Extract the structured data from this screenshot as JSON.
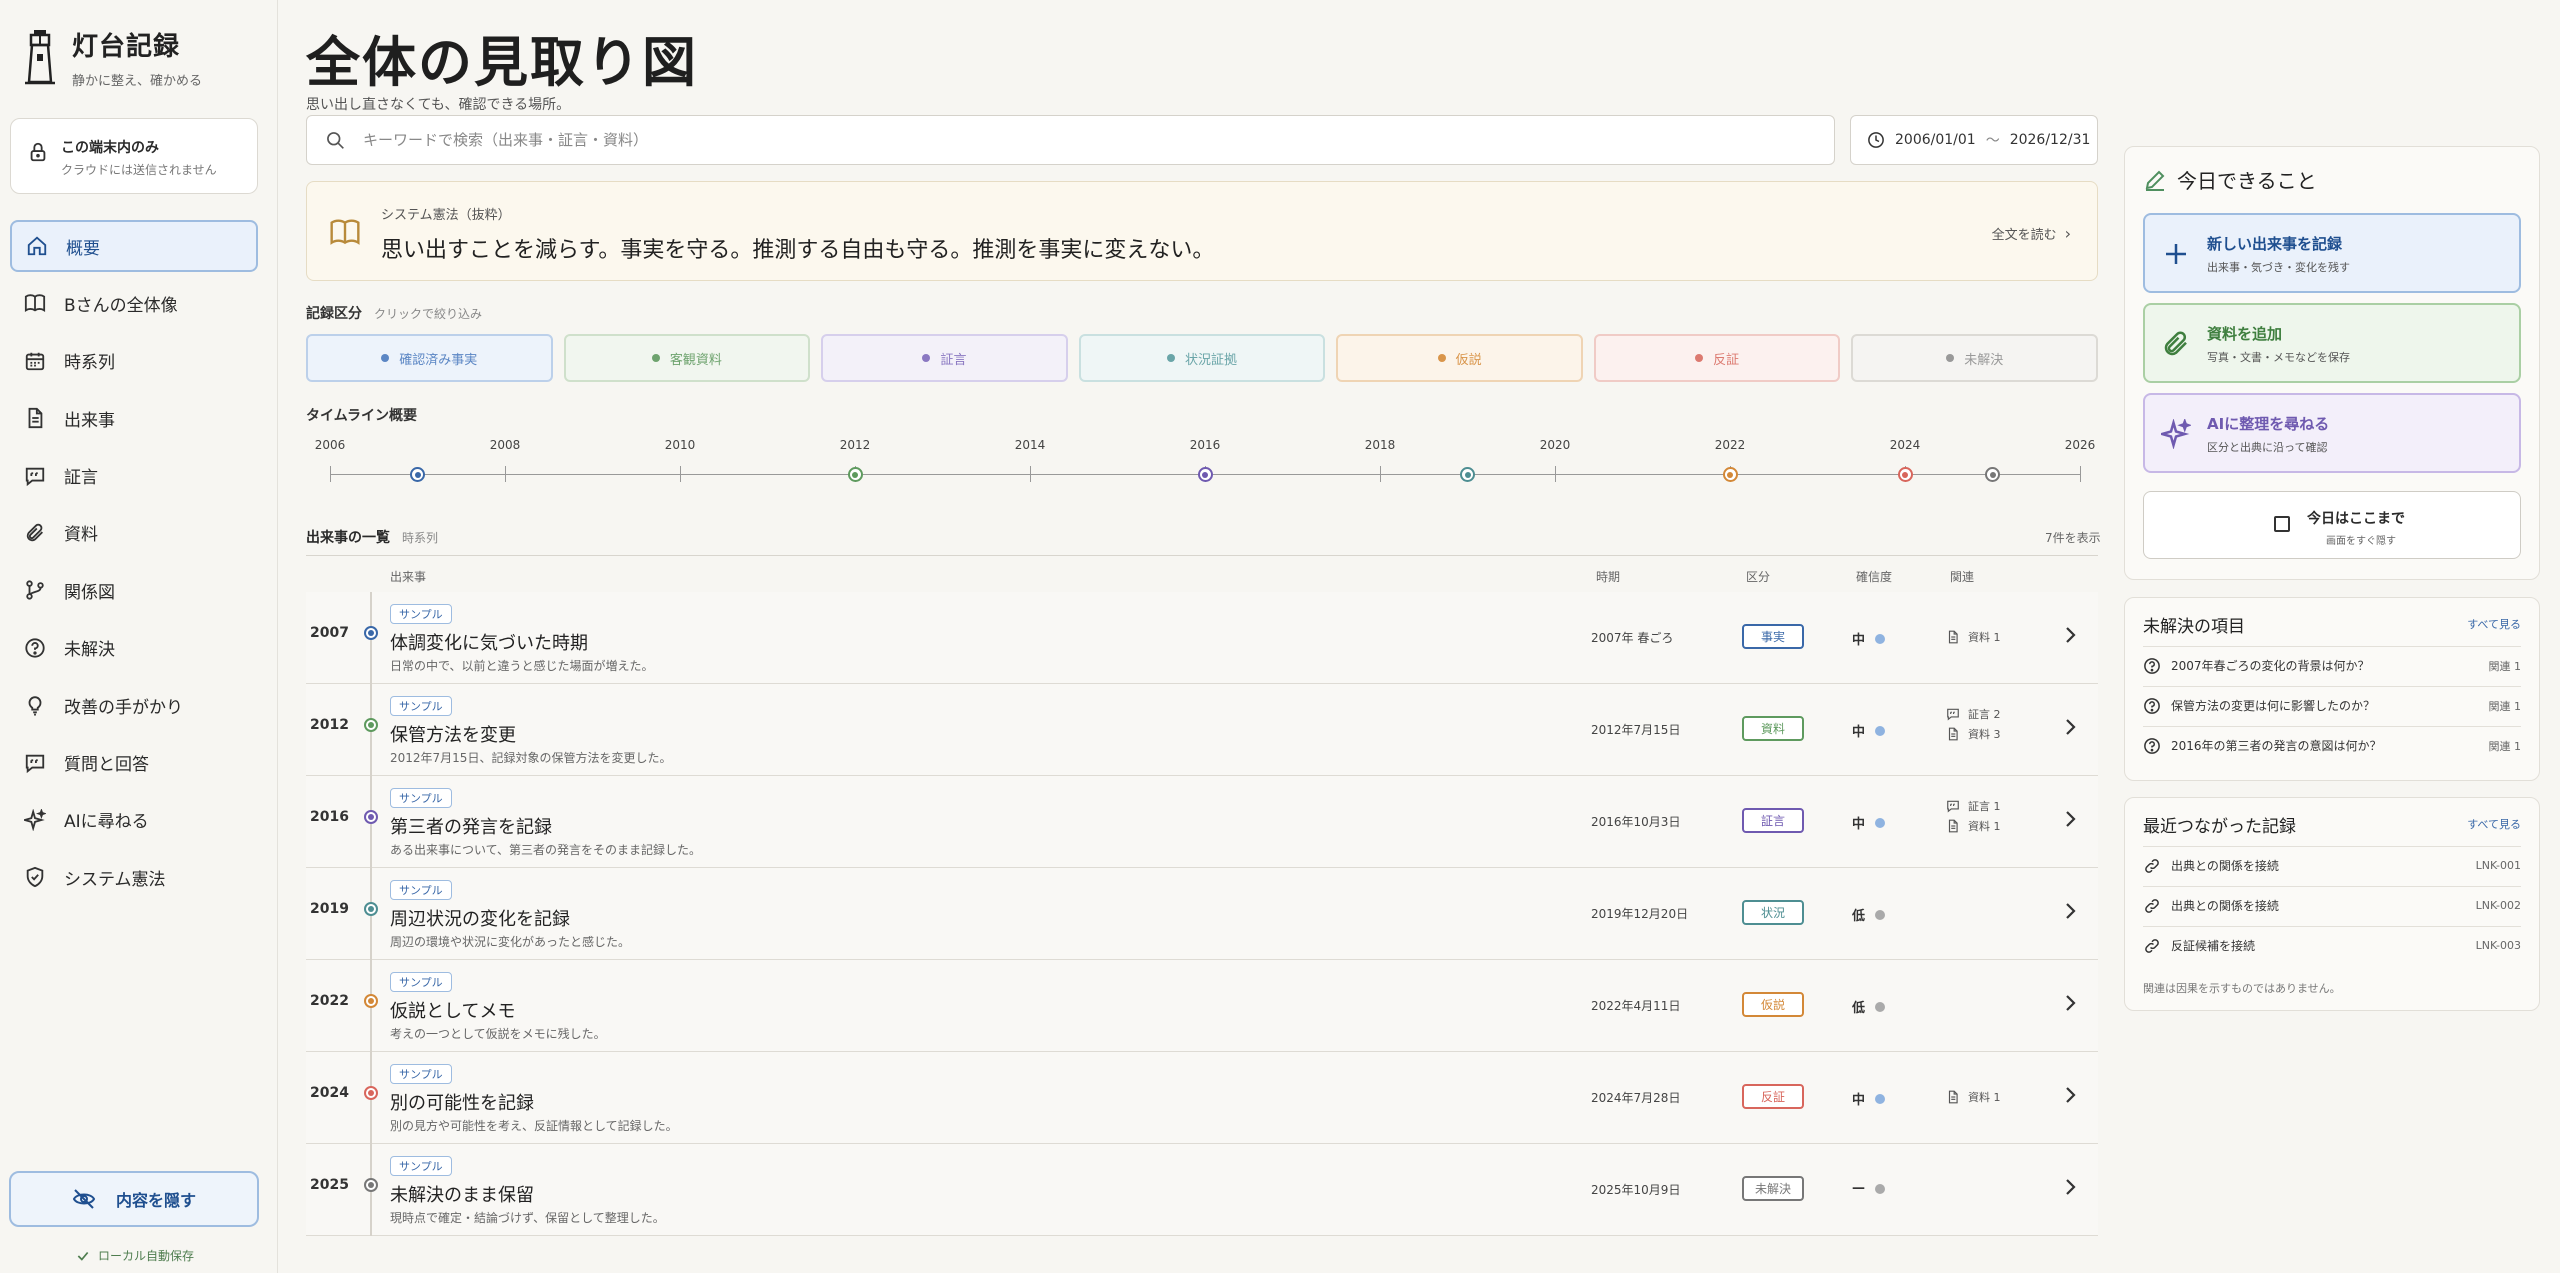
{
  "brand": {
    "title": "灯台記録",
    "subtitle": "静かに整え、確かめる"
  },
  "local_card": {
    "title": "この端末内のみ",
    "subtitle": "クラウドには送信されません"
  },
  "nav": [
    {
      "label": "概要",
      "icon": "home-icon"
    },
    {
      "label": "Bさんの全体像",
      "icon": "book-icon"
    },
    {
      "label": "時系列",
      "icon": "calendar-icon"
    },
    {
      "label": "出来事",
      "icon": "document-icon"
    },
    {
      "label": "証言",
      "icon": "quote-icon"
    },
    {
      "label": "資料",
      "icon": "paperclip-icon"
    },
    {
      "label": "関係図",
      "icon": "branch-icon"
    },
    {
      "label": "未解決",
      "icon": "question-icon"
    },
    {
      "label": "改善の手がかり",
      "icon": "lightbulb-icon"
    },
    {
      "label": "質問と回答",
      "icon": "chat-icon"
    },
    {
      "label": "AIに尋ねる",
      "icon": "sparkle-icon"
    },
    {
      "label": "システム憲法",
      "icon": "shield-icon"
    }
  ],
  "hide_button": "内容を隠す",
  "autosave": "ローカル自動保存",
  "page": {
    "title": "全体の見取り図",
    "subtitle": "思い出し直さなくても、確認できる場所。"
  },
  "search": {
    "placeholder": "キーワードで検索（出来事・証言・資料）"
  },
  "daterange": {
    "start": "2006/01/01",
    "sep": "〜",
    "end": "2026/12/31"
  },
  "constitution": {
    "label": "システム憲法（抜粋）",
    "text": "思い出すことを減らす。事実を守る。推測する自由も守る。推測を事実に変えない。",
    "link": "全文を読む"
  },
  "filters": {
    "heading": "記録区分",
    "hint": "クリックで絞り込み",
    "items": [
      {
        "label": "確認済み事実",
        "color": "#5b86c4",
        "bg": "#edf3fb",
        "border": "#bcd0ea"
      },
      {
        "label": "客観資料",
        "color": "#6ea36e",
        "bg": "#f1f6ef",
        "border": "#cfe0cb"
      },
      {
        "label": "証言",
        "color": "#8a78c2",
        "bg": "#f3f1f9",
        "border": "#d6cfec"
      },
      {
        "label": "状況証拠",
        "color": "#6aa5a8",
        "bg": "#eff6f6",
        "border": "#c9e0e0"
      },
      {
        "label": "仮説",
        "color": "#d9954a",
        "bg": "#fcf4ea",
        "border": "#efd4b4"
      },
      {
        "label": "反証",
        "color": "#dc7a70",
        "bg": "#fcf1ef",
        "border": "#f0cbc6"
      },
      {
        "label": "未解決",
        "color": "#999999",
        "bg": "#f5f4f2",
        "border": "#dcdad5"
      }
    ]
  },
  "timeline": {
    "heading": "タイムライン概要",
    "ticks": [
      "2006",
      "2008",
      "2010",
      "2012",
      "2014",
      "2016",
      "2018",
      "2020",
      "2022",
      "2024",
      "2026"
    ],
    "start_year": 2006,
    "end_year": 2026,
    "events": [
      {
        "year": 2007.0,
        "color": "#3a68a8"
      },
      {
        "year": 2012.0,
        "color": "#5e9a5e"
      },
      {
        "year": 2016.0,
        "color": "#6f5ab0"
      },
      {
        "year": 2019.0,
        "color": "#4e8e92"
      },
      {
        "year": 2022.0,
        "color": "#d38837"
      },
      {
        "year": 2024.0,
        "color": "#d8665c"
      },
      {
        "year": 2025.0,
        "color": "#777777"
      }
    ]
  },
  "list": {
    "heading": "出来事の一覧",
    "hint": "時系列",
    "count": "7件を表示",
    "columns": {
      "event": "出来事",
      "period": "時期",
      "category": "区分",
      "confidence": "確信度",
      "related": "関連"
    },
    "rows": [
      {
        "year": "2007",
        "tag": "サンプル",
        "title": "体調変化に気づいた時期",
        "desc": "日常の中で、以前と違うと感じた場面が増えた。",
        "date": "2007年 春ごろ",
        "badge": "事実",
        "badge_color": "#3a68a8",
        "conf": "中",
        "conf_color": "#8fb3e0",
        "node_color": "#3a68a8",
        "rel": [
          {
            "icon": "document-icon",
            "text": "資料 1"
          }
        ]
      },
      {
        "year": "2012",
        "tag": "サンプル",
        "title": "保管方法を変更",
        "desc": "2012年7月15日、記録対象の保管方法を変更した。",
        "date": "2012年7月15日",
        "badge": "資料",
        "badge_color": "#5e9a5e",
        "conf": "中",
        "conf_color": "#8fb3e0",
        "node_color": "#5e9a5e",
        "rel": [
          {
            "icon": "quote-icon",
            "text": "証言 2"
          },
          {
            "icon": "document-icon",
            "text": "資料 3"
          }
        ]
      },
      {
        "year": "2016",
        "tag": "サンプル",
        "title": "第三者の発言を記録",
        "desc": "ある出来事について、第三者の発言をそのまま記録した。",
        "date": "2016年10月3日",
        "badge": "証言",
        "badge_color": "#6f5ab0",
        "conf": "中",
        "conf_color": "#8fb3e0",
        "node_color": "#6f5ab0",
        "rel": [
          {
            "icon": "quote-icon",
            "text": "証言 1"
          },
          {
            "icon": "document-icon",
            "text": "資料 1"
          }
        ]
      },
      {
        "year": "2019",
        "tag": "サンプル",
        "title": "周辺状況の変化を記録",
        "desc": "周辺の環境や状況に変化があったと感じた。",
        "date": "2019年12月20日",
        "badge": "状況",
        "badge_color": "#4e8e92",
        "conf": "低",
        "conf_color": "#aaaaaa",
        "node_color": "#4e8e92",
        "rel": []
      },
      {
        "year": "2022",
        "tag": "サンプル",
        "title": "仮説としてメモ",
        "desc": "考えの一つとして仮説をメモに残した。",
        "date": "2022年4月11日",
        "badge": "仮説",
        "badge_color": "#d38837",
        "conf": "低",
        "conf_color": "#aaaaaa",
        "node_color": "#d38837",
        "rel": []
      },
      {
        "year": "2024",
        "tag": "サンプル",
        "title": "別の可能性を記録",
        "desc": "別の見方や可能性を考え、反証情報として記録した。",
        "date": "2024年7月28日",
        "badge": "反証",
        "badge_color": "#d8665c",
        "conf": "中",
        "conf_color": "#8fb3e0",
        "node_color": "#d8665c",
        "rel": [
          {
            "icon": "document-icon",
            "text": "資料 1"
          }
        ]
      },
      {
        "year": "2025",
        "tag": "サンプル",
        "title": "未解決のまま保留",
        "desc": "現時点で確定・結論づけず、保留として整理した。",
        "date": "2025年10月9日",
        "badge": "未解決",
        "badge_color": "#777777",
        "conf": "—",
        "conf_color": "#aaaaaa",
        "node_color": "#777777",
        "rel": []
      }
    ]
  },
  "today": {
    "title": "今日できること",
    "actions": [
      {
        "title": "新しい出来事を記録",
        "sub": "出来事・気づき・変化を残す",
        "icon": "plus-icon"
      },
      {
        "title": "資料を追加",
        "sub": "写真・文書・メモなどを保存",
        "icon": "paperclip-icon"
      },
      {
        "title": "AIに整理を尋ねる",
        "sub": "区分と出典に沿って確認",
        "icon": "sparkle-icon"
      }
    ],
    "stop": {
      "title": "今日はここまで",
      "sub": "画面をすぐ隠す"
    }
  },
  "unresolved": {
    "title": "未解決の項目",
    "more": "すべて見る",
    "items": [
      {
        "text": "2007年春ごろの変化の背景は何か？",
        "rel": "関連 1"
      },
      {
        "text": "保管方法の変更は何に影響したのか？",
        "rel": "関連 1"
      },
      {
        "text": "2016年の第三者の発言の意図は何か？",
        "rel": "関連 1"
      }
    ]
  },
  "recent": {
    "title": "最近つながった記録",
    "more": "すべて見る",
    "items": [
      {
        "text": "出典との関係を接続",
        "id": "LNK-001"
      },
      {
        "text": "出典との関係を接続",
        "id": "LNK-002"
      },
      {
        "text": "反証候補を接続",
        "id": "LNK-003"
      }
    ],
    "note": "関連は因果を示すものではありません。"
  }
}
